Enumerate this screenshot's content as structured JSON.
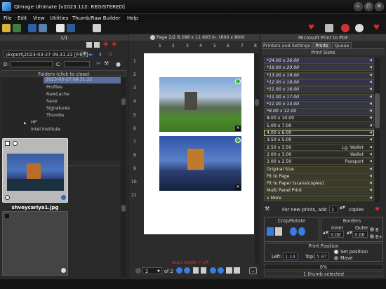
{
  "app": {
    "title": "Qimage Ultimate [v2023.112: REGISTERED]"
  },
  "menu": [
    "File",
    "Edit",
    "View",
    "Utilities",
    "Thumb/Raw Builder",
    "Help"
  ],
  "left": {
    "page_num": "1/1",
    "path_value": "\\Export\\2023-03-27 09.31.22 [Files]",
    "d_label": "D:",
    "c_label": "C:",
    "folders_header": "Folders (click to close)",
    "tree": [
      "2023-03-27 09.31.22",
      "Profiles",
      "RawCache",
      "Save",
      "Signatures",
      "Thumbs",
      "HP",
      "Intel Institute"
    ],
    "thumb_caption": "shveycariya1.jpg"
  },
  "center": {
    "header": "Page 2/2  8.288 x 11.693 in. (600 x 800)",
    "ruler_top": [
      "1",
      "2",
      "3",
      "4",
      "5",
      "6",
      "7",
      "8"
    ],
    "ruler_left": [
      "1",
      "2",
      "3",
      "4",
      "5",
      "6",
      "7",
      "8",
      "9",
      "10",
      "11"
    ],
    "auto_rotate": "Auto rotate = off",
    "page_select": "2",
    "of_pages": "of 2"
  },
  "right": {
    "header": "Microsoft Print to PDF",
    "tabs": [
      "Printers and Settings",
      "Prints",
      "Queue"
    ],
    "print_sizes_label": "Print Sizes",
    "sizes": [
      {
        "label": "*24.00 x 36.00",
        "tag": ""
      },
      {
        "label": "*16.00 x 20.00",
        "tag": ""
      },
      {
        "label": "*13.00 x 19.00",
        "tag": ""
      },
      {
        "label": "*12.00 x 18.00",
        "tag": ""
      },
      {
        "label": "*11.00 x 16.00",
        "tag": ""
      },
      {
        "label": "*11.00 x 17.00",
        "tag": ""
      },
      {
        "label": "*11.00 x 14.00",
        "tag": ""
      },
      {
        "label": "*8.00 x 12.00",
        "tag": ""
      },
      {
        "label": "8.00 x 10.00",
        "tag": ""
      },
      {
        "label": "5.00 x 7.00",
        "tag": ""
      },
      {
        "label": "4.00 x 6.00",
        "tag": ""
      },
      {
        "label": "3.50 x 5.00",
        "tag": ""
      },
      {
        "label": "2.50 x 3.50",
        "tag": "Lg. Wallet"
      },
      {
        "label": "2.00 x 3.00",
        "tag": "Wallet"
      },
      {
        "label": "2.00 x 2.50",
        "tag": "Passport"
      },
      {
        "label": "Original Size",
        "tag": ""
      },
      {
        "label": "Fit to Page",
        "tag": ""
      },
      {
        "label": "Fit to Paper (scans/copies)",
        "tag": ""
      },
      {
        "label": "Multi Panel Print",
        "tag": ""
      },
      {
        "label": "v More",
        "tag": ""
      }
    ],
    "new_prints_label": "For new prints, add",
    "copies_value": "1",
    "copies_label": "copies",
    "crop_rotate": "Crop/Rotate",
    "borders": "Borders",
    "inner_label": "Inner",
    "outer_label": "Outer",
    "inner_value": "0.00",
    "outer_value": "0.00",
    "b_label": "B",
    "bplus_label": "B+",
    "print_position": "Print Position",
    "left_label": "Left:",
    "left_value": "1.14",
    "top_label": "Top:",
    "top_value": "5.97",
    "set_position": "Set position",
    "move": "Move",
    "progress": "0%",
    "status": "1 thumb selected"
  },
  "colors": {
    "accent_red": "#d42b2b",
    "selected_blue": "#5a6fa0",
    "size_row": "#3b3b2a"
  }
}
